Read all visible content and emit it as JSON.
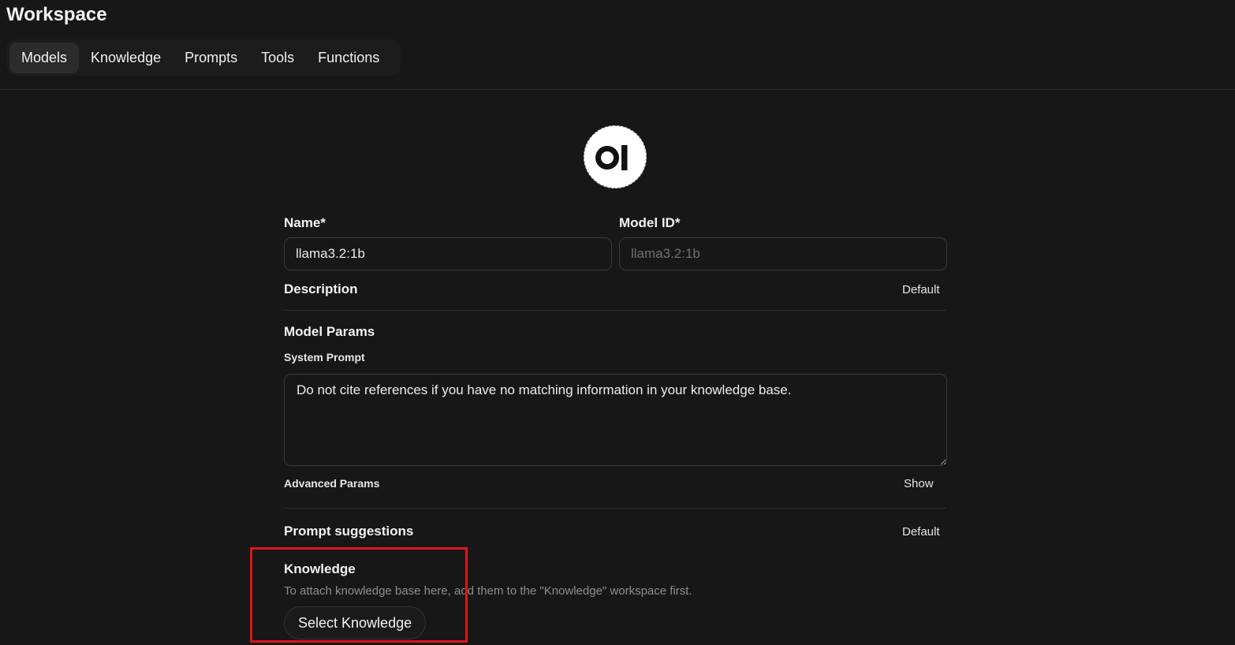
{
  "header": {
    "title": "Workspace",
    "tabs": [
      {
        "label": "Models",
        "active": true
      },
      {
        "label": "Knowledge",
        "active": false
      },
      {
        "label": "Prompts",
        "active": false
      },
      {
        "label": "Tools",
        "active": false
      },
      {
        "label": "Functions",
        "active": false
      }
    ]
  },
  "model": {
    "logo_icon": "openwebui-logo-icon",
    "name_label": "Name*",
    "name_value": "llama3.2:1b",
    "model_id_label": "Model ID*",
    "model_id_placeholder": "llama3.2:1b",
    "description_label": "Description",
    "description_action": "Default",
    "params_label": "Model Params",
    "system_prompt_label": "System Prompt",
    "system_prompt_value": "Do not cite references if you have no matching information in your knowledge base.",
    "advanced_params_label": "Advanced Params",
    "advanced_params_action": "Show",
    "prompt_suggestions_label": "Prompt suggestions",
    "prompt_suggestions_action": "Default",
    "knowledge_label": "Knowledge",
    "knowledge_helper": "To attach knowledge base here, add them to the \"Knowledge\" workspace first.",
    "select_knowledge_label": "Select Knowledge"
  },
  "colors": {
    "background": "#171717",
    "highlight_box": "#e0141b"
  }
}
